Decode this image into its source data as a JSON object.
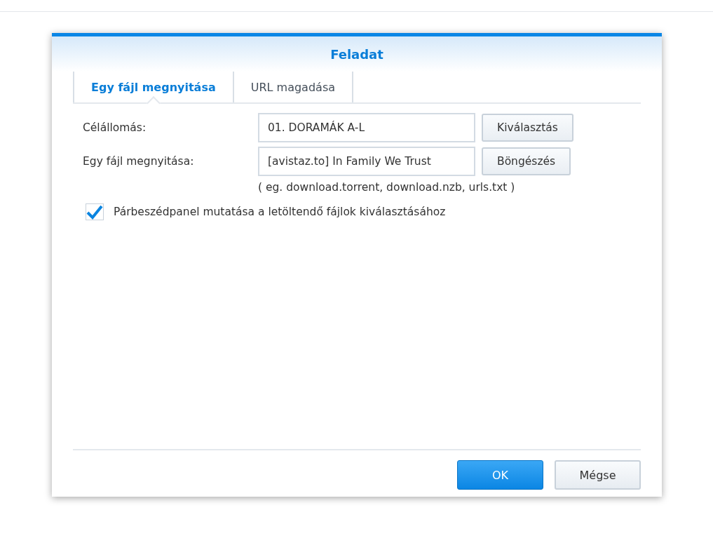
{
  "dialog": {
    "title": "Feladat",
    "tabs": [
      {
        "label": "Egy fájl megnyitása",
        "selected": true
      },
      {
        "label": "URL magadása",
        "selected": false
      }
    ],
    "fields": [
      {
        "label": "Célállomás:",
        "value": "01. DORAMÁK A-L",
        "button": "Kiválasztás"
      },
      {
        "label": "Egy fájl megnyitása:",
        "value": "[avistaz.to] In Family We Trust",
        "button": "Böngészés"
      }
    ],
    "hint": "( eg. download.torrent, download.nzb, urls.txt )",
    "checkbox": {
      "label": "Párbeszédpanel mutatása a letöltendő fájlok kiválasztásához",
      "checked": true
    },
    "buttons": [
      {
        "label": "OK",
        "kind": "primary"
      },
      {
        "label": "Mégse",
        "kind": "secondary"
      }
    ]
  }
}
